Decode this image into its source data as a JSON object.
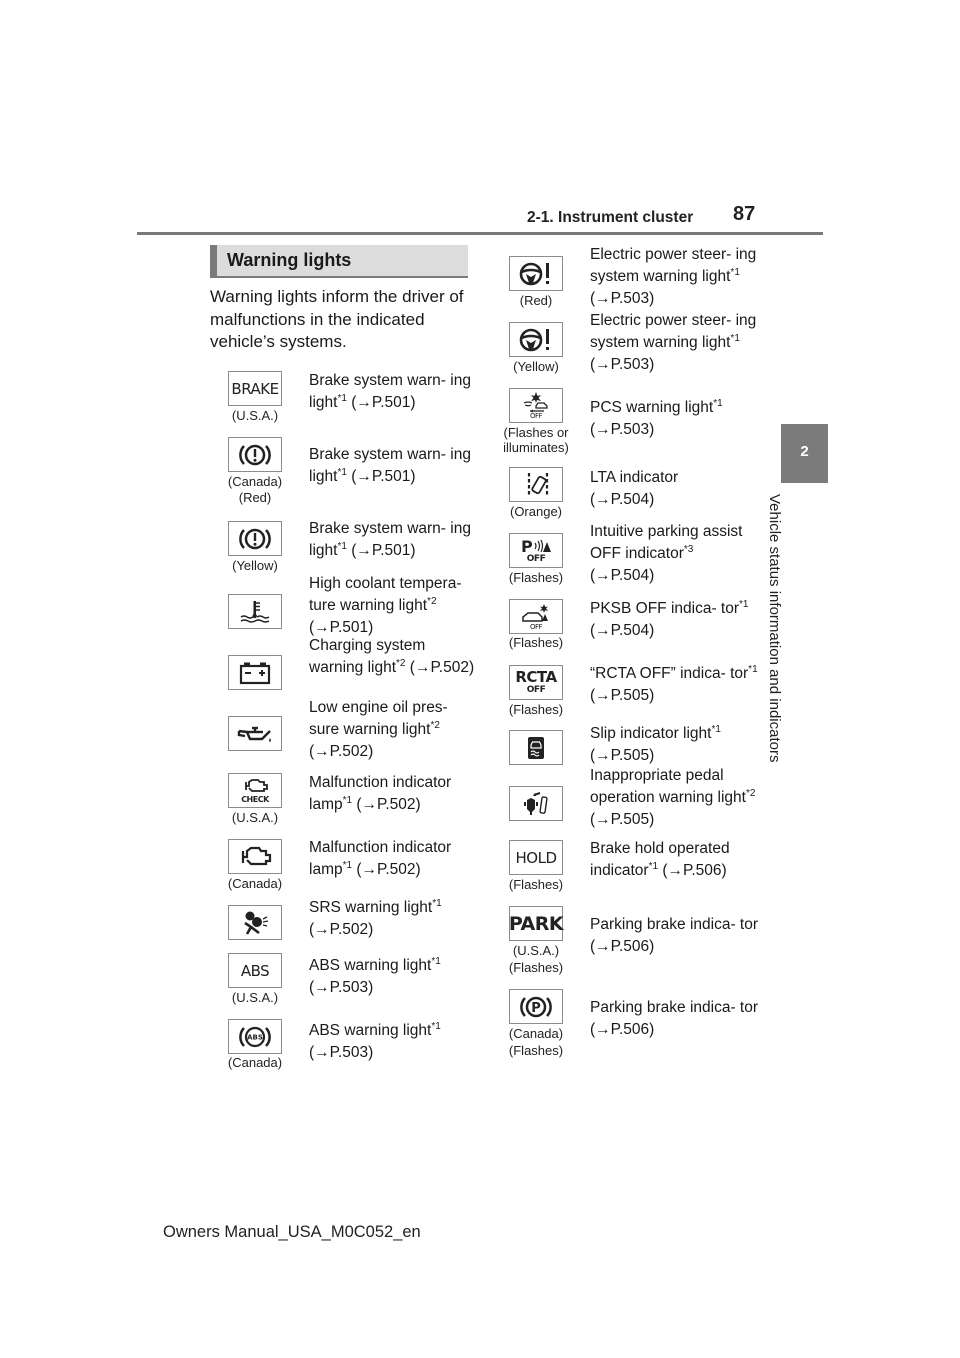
{
  "header": {
    "section": "2-1. Instrument cluster",
    "page_number": "87"
  },
  "side_tab": {
    "number": "2",
    "label": "Vehicle status information and indicators"
  },
  "section_title": "Warning lights",
  "intro": "Warning lights inform the driver of malfunctions in the indicated vehicle’s systems.",
  "left_items": [
    {
      "icon": "brake-text-icon",
      "icon_text": "BRAKE",
      "caption": [
        "(U.S.A.)"
      ],
      "desc_before": "Brake system warn- ing light",
      "sup": "*1",
      "desc_after": " (→P.501)"
    },
    {
      "icon": "brake-circle-icon",
      "caption": [
        "(Canada)",
        "(Red)"
      ],
      "desc_before": "Brake system warn- ing light",
      "sup": "*1",
      "desc_after": " (→P.501)"
    },
    {
      "icon": "brake-circle-icon",
      "caption": [
        "(Yellow)"
      ],
      "desc_before": "Brake system warn- ing light",
      "sup": "*1",
      "desc_after": " (→P.501)"
    },
    {
      "icon": "coolant-temperature-icon",
      "caption": [],
      "desc_before": "High coolant tempera- ture warning light",
      "sup": "*2",
      "desc_after": " (→P.501)"
    },
    {
      "icon": "battery-icon",
      "caption": [],
      "desc_before": "Charging system warning light",
      "sup": "*2",
      "desc_after": " (→P.502)"
    },
    {
      "icon": "oil-can-icon",
      "caption": [],
      "desc_before": "Low engine oil pres- sure warning light",
      "sup": "*2",
      "desc_after": " (→P.502)"
    },
    {
      "icon": "engine-check-icon",
      "icon_text": "CHECK",
      "caption": [
        "(U.S.A.)"
      ],
      "desc_before": "Malfunction indicator lamp",
      "sup": "*1",
      "desc_after": " (→P.502)"
    },
    {
      "icon": "engine-icon",
      "caption": [
        "(Canada)"
      ],
      "desc_before": "Malfunction indicator lamp",
      "sup": "*1",
      "desc_after": " (→P.502)"
    },
    {
      "icon": "airbag-icon",
      "caption": [],
      "desc_before": "SRS warning light",
      "sup": "*1",
      "desc_after": " (→P.502)"
    },
    {
      "icon": "abs-text-icon",
      "icon_text": "ABS",
      "caption": [
        "(U.S.A.)"
      ],
      "desc_before": "ABS warning light",
      "sup": "*1",
      "desc_after": " (→P.503)"
    },
    {
      "icon": "abs-circle-icon",
      "icon_text": "ABS",
      "caption": [
        "(Canada)"
      ],
      "desc_before": "ABS warning light",
      "sup": "*1",
      "desc_after": " (→P.503)"
    }
  ],
  "right_items": [
    {
      "icon": "steering-warning-icon",
      "caption": [
        "(Red)"
      ],
      "desc_before": "Electric power steer- ing system warning light",
      "sup": "*1",
      "desc_after": " (→P.503)"
    },
    {
      "icon": "steering-warning-icon",
      "caption": [
        "(Yellow)"
      ],
      "desc_before": "Electric power steer- ing system warning light",
      "sup": "*1",
      "desc_after": " (→P.503)"
    },
    {
      "icon": "pcs-icon",
      "icon_text": "OFF",
      "caption": [
        "(Flashes or",
        "illuminates)"
      ],
      "desc_before": "PCS warning light",
      "sup": "*1",
      "desc_after": " (→P.503)"
    },
    {
      "icon": "lta-icon",
      "caption": [
        "(Orange)"
      ],
      "desc_before": "LTA indicator",
      "sup": "",
      "desc_after": " (→P.504)"
    },
    {
      "icon": "parking-assist-off-icon",
      "icon_text": "OFF",
      "caption": [
        "(Flashes)"
      ],
      "desc_before": "Intuitive parking assist OFF indicator",
      "sup": "*3",
      "desc_after": " (→P.504)"
    },
    {
      "icon": "pksb-off-icon",
      "icon_text": "OFF",
      "caption": [
        "(Flashes)"
      ],
      "desc_before": "PKSB OFF indica- tor",
      "sup": "*1",
      "desc_after": " (→P.504)"
    },
    {
      "icon": "rcta-off-icon",
      "icon_text": "RCTA",
      "icon_text2": "OFF",
      "caption": [
        "(Flashes)"
      ],
      "desc_before": "“RCTA OFF” indica- tor",
      "sup": "*1",
      "desc_after": " (→P.505)"
    },
    {
      "icon": "slip-indicator-icon",
      "caption": [],
      "desc_before": "Slip indicator light",
      "sup": "*1",
      "desc_after": " (→P.505)"
    },
    {
      "icon": "pedal-warning-icon",
      "caption": [],
      "desc_before": "Inappropriate pedal operation warning light",
      "sup": "*2",
      "desc_after": " (→P.505)"
    },
    {
      "icon": "hold-text-icon",
      "icon_text": "HOLD",
      "caption": [
        "(Flashes)"
      ],
      "desc_before": "Brake hold operated indicator",
      "sup": "*1",
      "desc_after": " (→P.506)"
    },
    {
      "icon": "park-text-icon",
      "icon_text": "PARK",
      "caption": [
        "(U.S.A.)",
        "(Flashes)"
      ],
      "desc_before": "Parking brake indica- tor (→P.506)",
      "sup": "",
      "desc_after": ""
    },
    {
      "icon": "parking-brake-circle-icon",
      "icon_text": "P",
      "caption": [
        "(Canada)",
        "(Flashes)"
      ],
      "desc_before": "Parking brake indica- tor (→P.506)",
      "sup": "",
      "desc_after": ""
    }
  ],
  "footer": "Owners Manual_USA_M0C052_en"
}
